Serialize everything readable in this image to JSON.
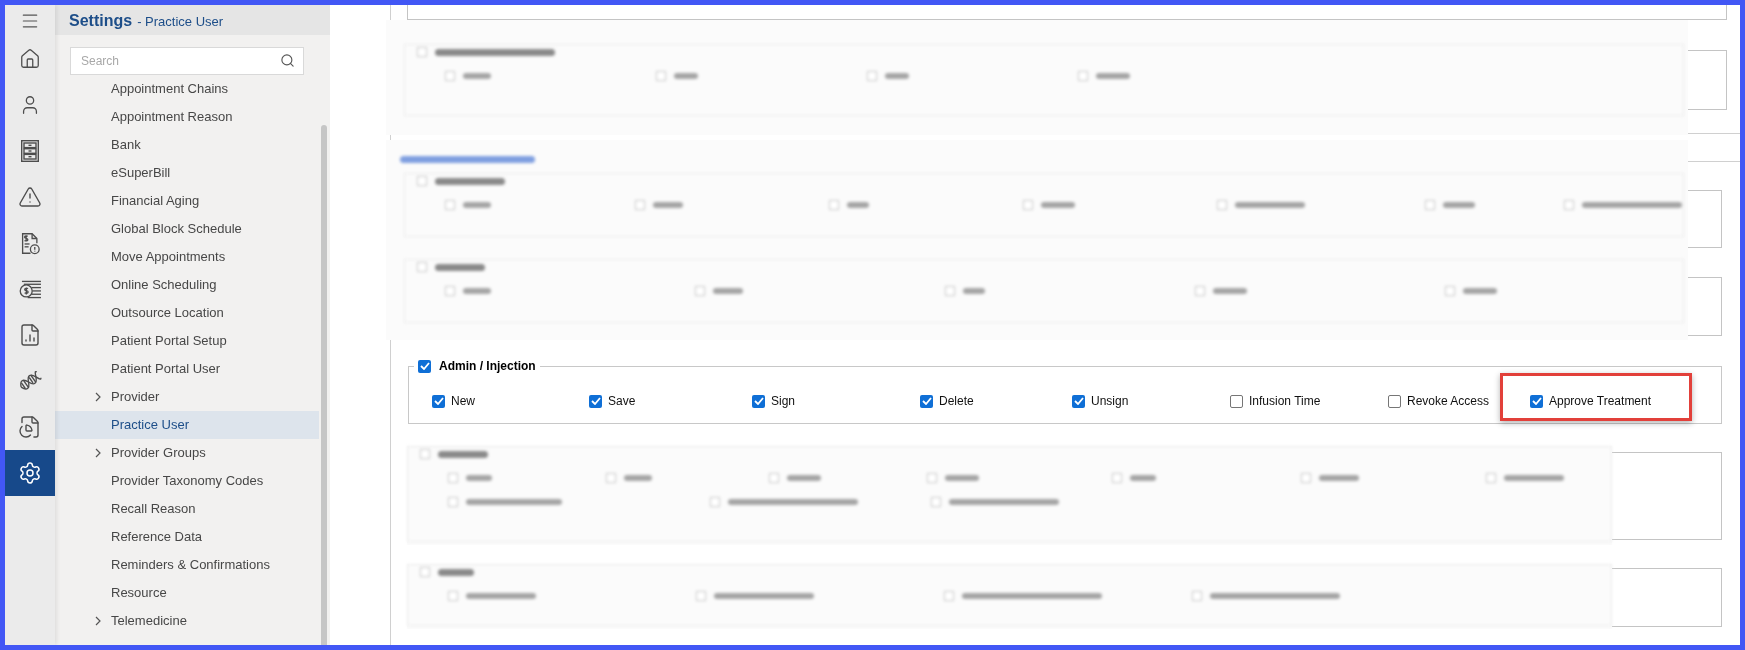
{
  "sidebar_nav": {
    "items": [
      {
        "selected": false
      },
      {
        "selected": false
      },
      {
        "selected": false
      },
      {
        "selected": false
      },
      {
        "selected": false
      },
      {
        "selected": false
      },
      {
        "selected": false
      },
      {
        "selected": false
      },
      {
        "selected": false
      },
      {
        "selected": true
      }
    ]
  },
  "settings_panel": {
    "title": "Settings",
    "subtitle": "- Practice User",
    "search": {
      "placeholder": "Search"
    },
    "items": [
      {
        "label": "Appointment Chains",
        "expandable": false,
        "selected": false
      },
      {
        "label": "Appointment Reason",
        "expandable": false,
        "selected": false
      },
      {
        "label": "Bank",
        "expandable": false,
        "selected": false
      },
      {
        "label": "eSuperBill",
        "expandable": false,
        "selected": false
      },
      {
        "label": "Financial Aging",
        "expandable": false,
        "selected": false
      },
      {
        "label": "Global Block Schedule",
        "expandable": false,
        "selected": false
      },
      {
        "label": "Move Appointments",
        "expandable": false,
        "selected": false
      },
      {
        "label": "Online Scheduling",
        "expandable": false,
        "selected": false
      },
      {
        "label": "Outsource Location",
        "expandable": false,
        "selected": false
      },
      {
        "label": "Patient Portal Setup",
        "expandable": false,
        "selected": false
      },
      {
        "label": "Patient Portal User",
        "expandable": false,
        "selected": false
      },
      {
        "label": "Provider",
        "expandable": true,
        "selected": false
      },
      {
        "label": "Practice User",
        "expandable": false,
        "selected": true
      },
      {
        "label": "Provider Groups",
        "expandable": true,
        "selected": false
      },
      {
        "label": "Provider Taxonomy Codes",
        "expandable": false,
        "selected": false
      },
      {
        "label": "Recall Reason",
        "expandable": false,
        "selected": false
      },
      {
        "label": "Reference Data",
        "expandable": false,
        "selected": false
      },
      {
        "label": "Reminders & Confirmations",
        "expandable": false,
        "selected": false
      },
      {
        "label": "Resource",
        "expandable": false,
        "selected": false
      },
      {
        "label": "Telemedicine",
        "expandable": true,
        "selected": false
      }
    ]
  },
  "admin_injection": {
    "label": "Admin / Injection",
    "checked": true,
    "permissions": [
      {
        "label": "New",
        "checked": true,
        "highlighted": false
      },
      {
        "label": "Save",
        "checked": true,
        "highlighted": false
      },
      {
        "label": "Sign",
        "checked": true,
        "highlighted": false
      },
      {
        "label": "Delete",
        "checked": true,
        "highlighted": false
      },
      {
        "label": "Unsign",
        "checked": true,
        "highlighted": false
      },
      {
        "label": "Infusion Time",
        "checked": false,
        "highlighted": false
      },
      {
        "label": "Revoke Access",
        "checked": false,
        "highlighted": false
      },
      {
        "label": "Approve Treatment",
        "checked": true,
        "highlighted": true
      }
    ]
  }
}
